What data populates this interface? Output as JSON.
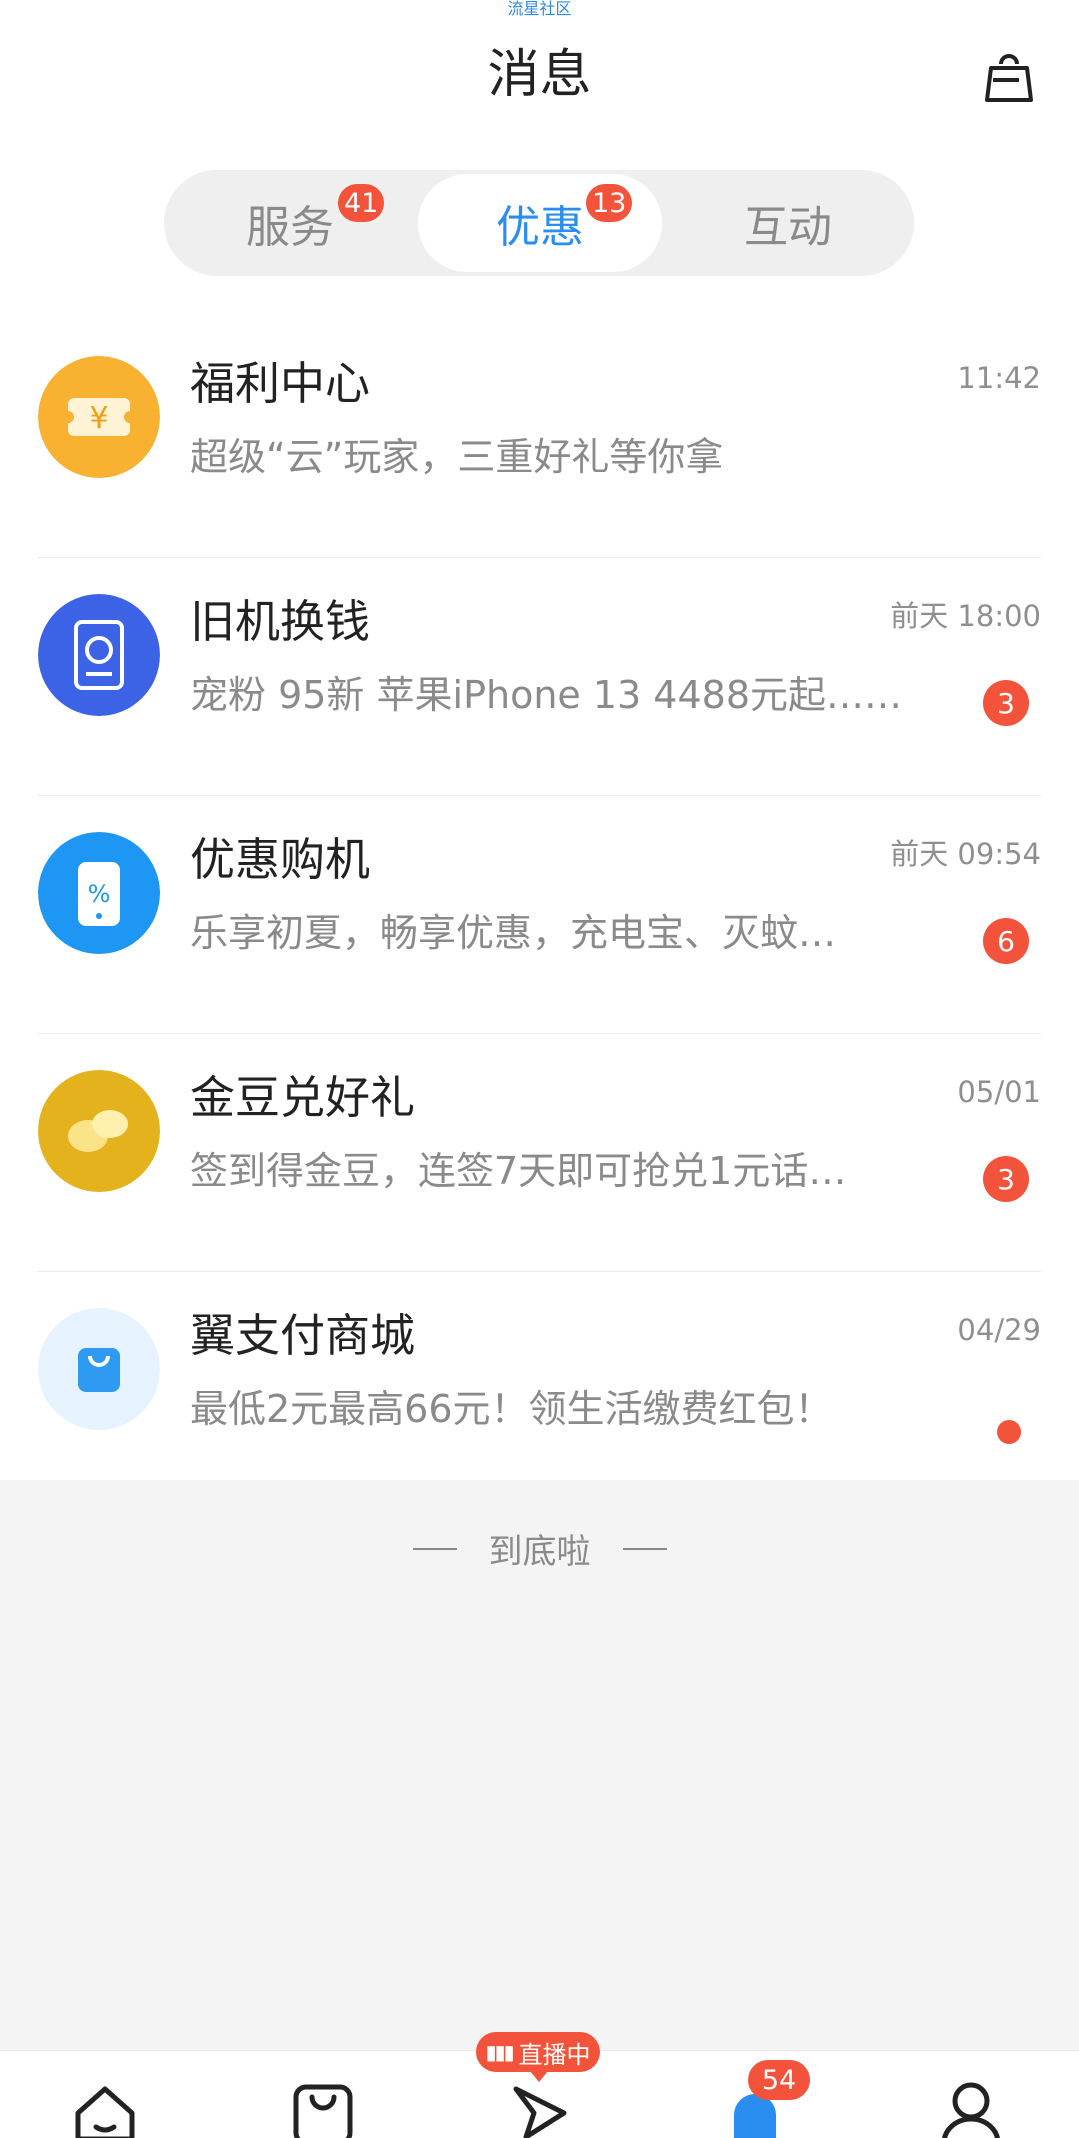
{
  "watermark": "流星社区",
  "header": {
    "title": "消息"
  },
  "tabs": [
    {
      "label": "服务",
      "badge": "41"
    },
    {
      "label": "优惠",
      "badge": "13",
      "active": true
    },
    {
      "label": "互动"
    }
  ],
  "messages": [
    {
      "name": "福利中心",
      "time": "11:42",
      "preview": "超级“云”玩家，三重好礼等你拿",
      "icon": "coupon-icon",
      "color": "#f9b132"
    },
    {
      "name": "旧机换钱",
      "time": "前天 18:00",
      "preview": "宠粉 95新 苹果iPhone 13 4488元起……",
      "count": "3",
      "icon": "phone-recycle-icon",
      "color": "#3c63e6"
    },
    {
      "name": "优惠购机",
      "time": "前天 09:54",
      "preview": "乐享初夏，畅享优惠，充电宝、灭蚊…",
      "count": "6",
      "icon": "phone-discount-icon",
      "color": "#1e96f3"
    },
    {
      "name": "金豆兑好礼",
      "time": "05/01",
      "preview": "签到得金豆，连签7天即可抢兑1元话…",
      "count": "3",
      "icon": "gold-bean-icon",
      "color": "#e3b21c"
    },
    {
      "name": "翼支付商城",
      "time": "04/29",
      "preview": "最低2元最高66元！领生活缴费红包！",
      "dot": true,
      "icon": "shopping-bag-icon",
      "color": "#2e9af2"
    }
  ],
  "end_text": "到底啦",
  "tabbar": {
    "live_label": "直播中",
    "notification_badge": "54",
    "items": [
      "home-icon",
      "shop-icon",
      "play-icon",
      "bell-icon",
      "user-icon"
    ],
    "active_color": "#2a8ef0"
  }
}
